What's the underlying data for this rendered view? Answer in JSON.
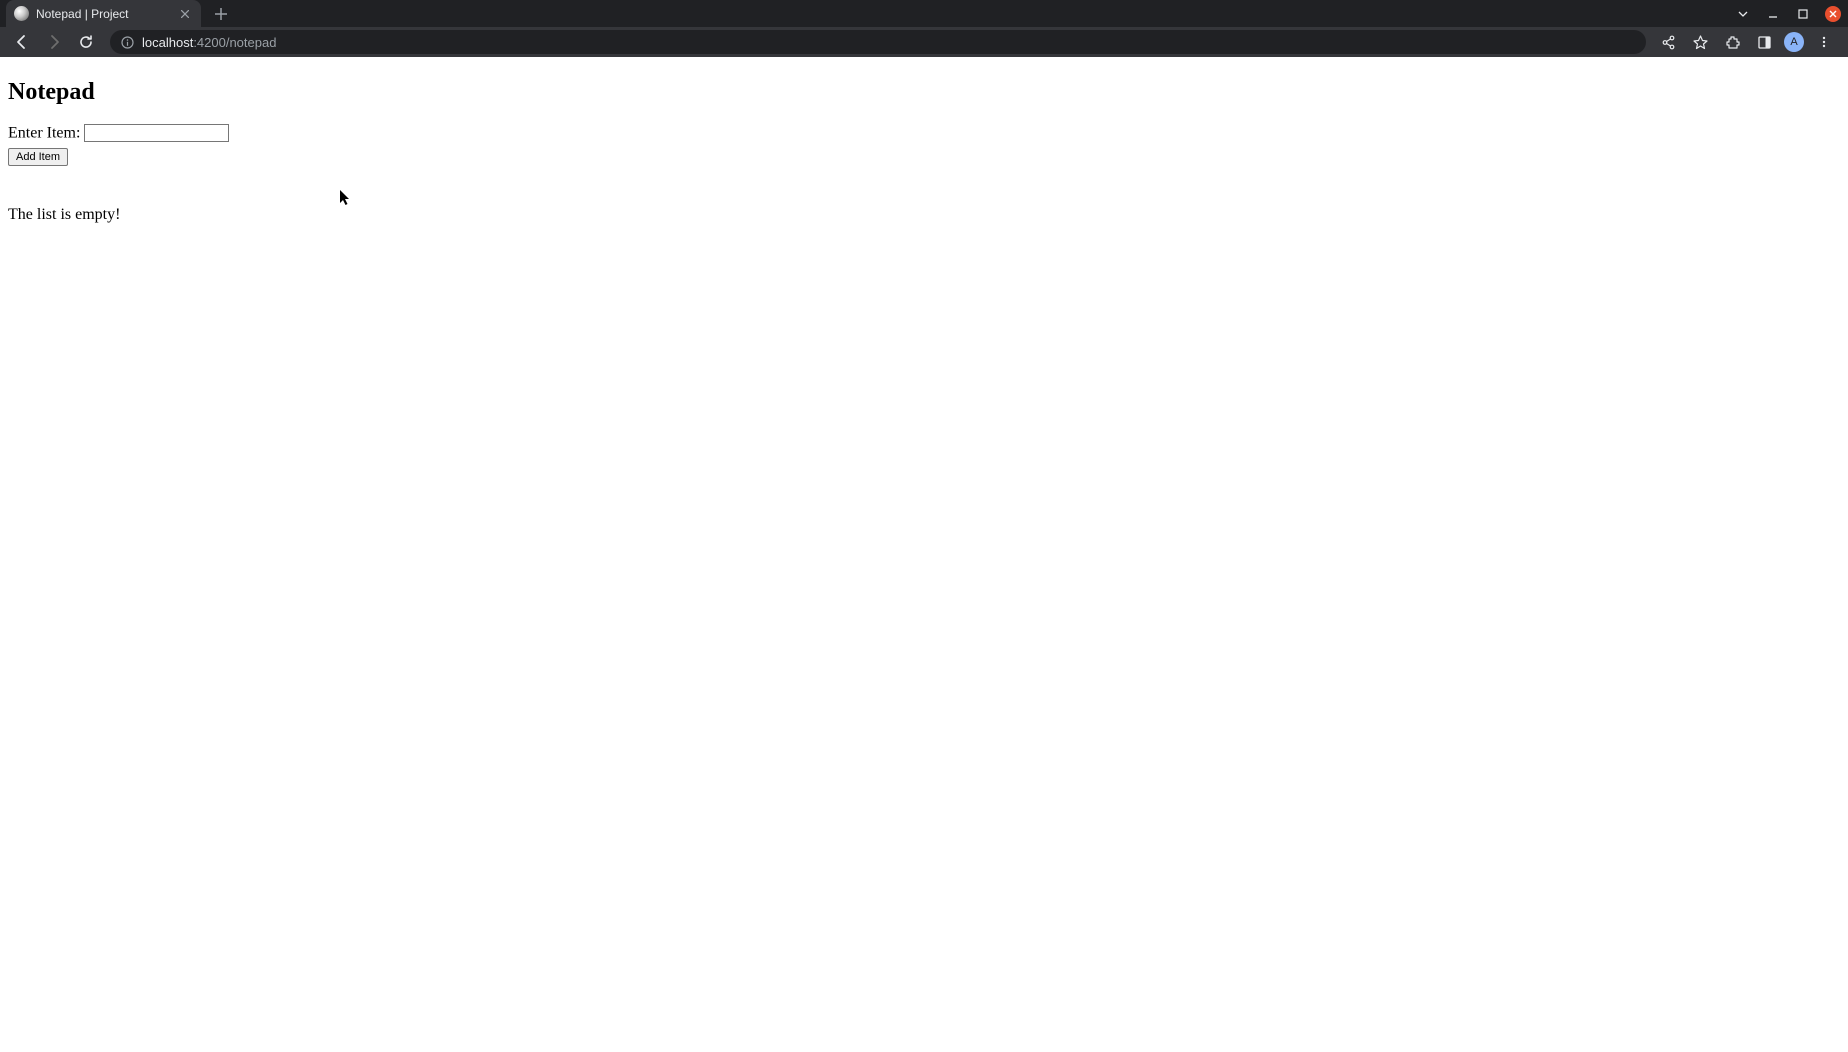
{
  "browser": {
    "tab_title": "Notepad | Project",
    "url_host": "localhost",
    "url_path": ":4200/notepad",
    "avatar_initial": "A"
  },
  "page": {
    "heading": "Notepad",
    "form_label": "Enter Item:",
    "input_value": "",
    "add_button_label": "Add Item",
    "empty_message": "The list is empty!"
  }
}
